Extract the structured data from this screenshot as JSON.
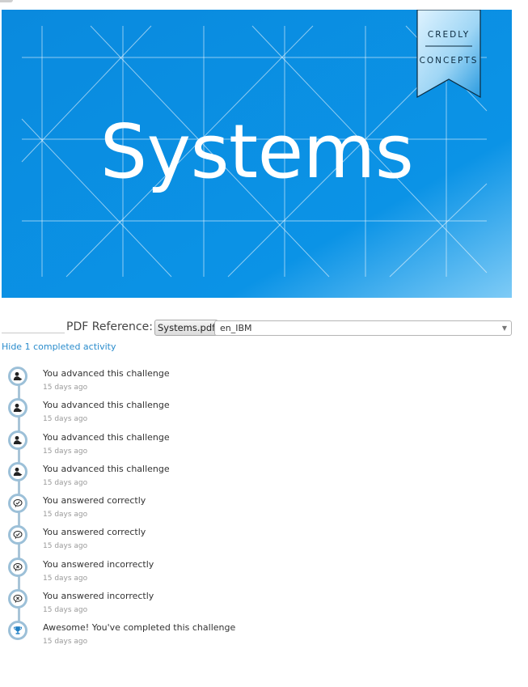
{
  "banner": {
    "title": "Systems",
    "ribbon_line1": "CREDLY",
    "ribbon_line2": "CONCEPTS",
    "colors": {
      "background": "#0b8fe0",
      "lines": "#ffffff",
      "ribbon": "#7cc6f1"
    }
  },
  "reference": {
    "label": "PDF Reference:",
    "pdf_button": "Systems.pdf",
    "language_selected": "en_IBM"
  },
  "activity_toggle": "Hide 1 completed activity",
  "activities": [
    {
      "icon": "user-advance-icon",
      "title": "You advanced this challenge",
      "time": "15 days ago"
    },
    {
      "icon": "user-advance-icon",
      "title": "You advanced this challenge",
      "time": "15 days ago"
    },
    {
      "icon": "user-advance-icon",
      "title": "You advanced this challenge",
      "time": "15 days ago"
    },
    {
      "icon": "user-advance-icon",
      "title": "You advanced this challenge",
      "time": "15 days ago"
    },
    {
      "icon": "chat-check-icon",
      "title": "You answered correctly",
      "time": "15 days ago"
    },
    {
      "icon": "chat-check-icon",
      "title": "You answered correctly",
      "time": "15 days ago"
    },
    {
      "icon": "chat-cross-icon",
      "title": "You answered incorrectly",
      "time": "15 days ago"
    },
    {
      "icon": "chat-cross-icon",
      "title": "You answered incorrectly",
      "time": "15 days ago"
    },
    {
      "icon": "trophy-icon",
      "title": "Awesome! You've completed this challenge",
      "time": "15 days ago"
    }
  ]
}
